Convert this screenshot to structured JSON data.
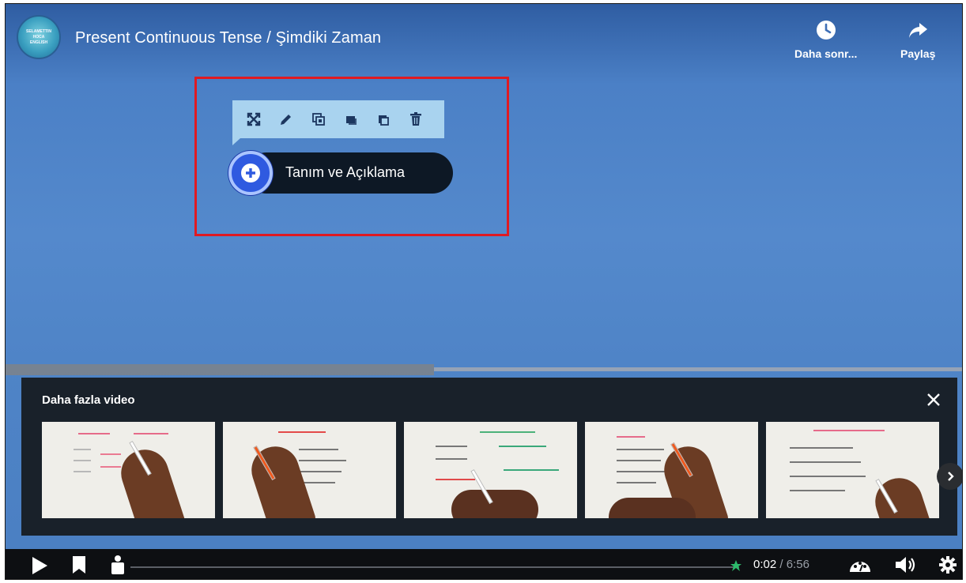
{
  "header": {
    "channel_logo_text": [
      "SELAMETTIN",
      "HOCA",
      "ENGLISH"
    ],
    "title": "Present Continuous Tense / Şimdiki Zaman",
    "watch_later_label": "Daha sonr...",
    "share_label": "Paylaş"
  },
  "annotation": {
    "toolbar_tools": [
      "expand-icon",
      "edit-icon",
      "duplicate-icon",
      "bring-forward-icon",
      "send-backward-icon",
      "delete-icon"
    ],
    "hotspot_label": "Tanım ve Açıklama",
    "highlight_color": "#e01a22"
  },
  "more_videos": {
    "title": "Daha fazla video",
    "close_icon": "close-icon",
    "next_icon": "chevron-right-icon",
    "thumbnails": [
      {
        "index": 1
      },
      {
        "index": 2
      },
      {
        "index": 3
      },
      {
        "index": 4
      },
      {
        "index": 5
      }
    ]
  },
  "controls": {
    "current_time": "0:02",
    "separator": " / ",
    "duration": "6:56",
    "icons": [
      "play-icon",
      "bookmark-icon",
      "scrub-handle-icon",
      "quality-icon",
      "volume-icon",
      "settings-icon"
    ]
  },
  "colors": {
    "video_blue": "#4f83c8",
    "toolbar_bg": "#a9d3ef",
    "hotspot_button": "#2f5ae0",
    "panel_bg": "#16191e"
  }
}
